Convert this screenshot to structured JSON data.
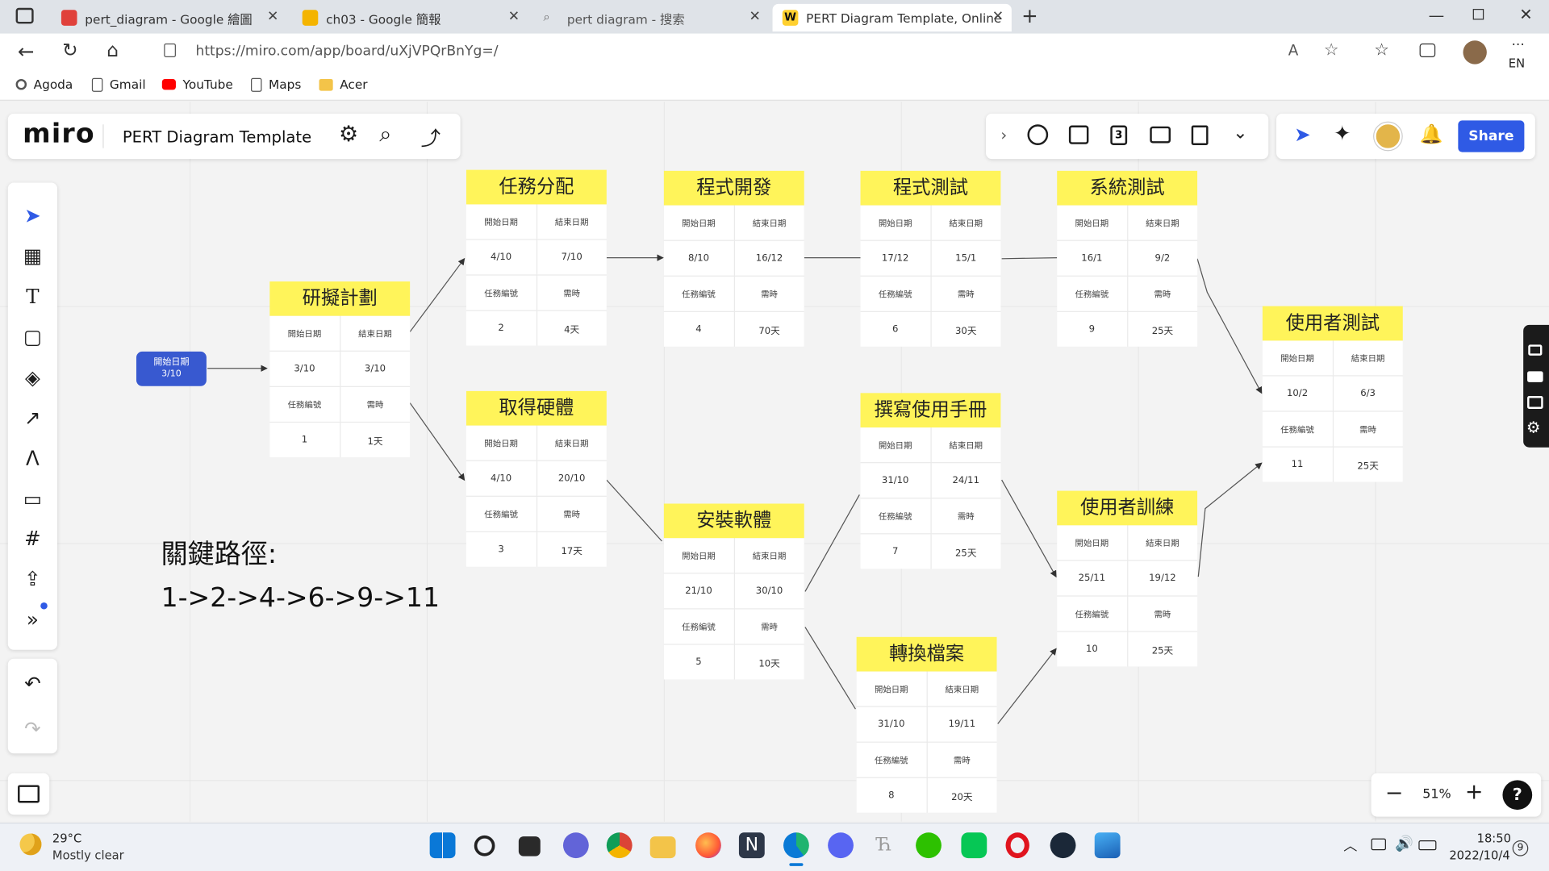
{
  "browser": {
    "tabs": [
      {
        "title": "pert_diagram - Google 繪圖",
        "icon": "google-drawings-icon"
      },
      {
        "title": "ch03 - Google 簡報",
        "icon": "google-slides-icon"
      },
      {
        "title": "pert diagram - 搜索",
        "icon": "search-icon"
      },
      {
        "title": "PERT Diagram Template, Online",
        "icon": "miro-icon"
      }
    ],
    "url": "https://miro.com/app/board/uXjVPQrBnYg=/",
    "lang": "EN",
    "bookmarks": [
      "Agoda",
      "Gmail",
      "YouTube",
      "Maps",
      "Acer"
    ]
  },
  "miro": {
    "logo": "miro",
    "board_title": "PERT Diagram Template",
    "share_label": "Share",
    "zoom": "51%",
    "help": "?",
    "toolbar_number_badge": "3"
  },
  "start": {
    "label": "開始日期",
    "date": "3/10"
  },
  "field_labels": {
    "start": "開始日期",
    "end": "結束日期",
    "id": "任務編號",
    "duration": "需時"
  },
  "tasks": [
    {
      "title": "研擬計劃",
      "start": "3/10",
      "end": "3/10",
      "id": "1",
      "duration": "1天"
    },
    {
      "title": "任務分配",
      "start": "4/10",
      "end": "7/10",
      "id": "2",
      "duration": "4天"
    },
    {
      "title": "取得硬體",
      "start": "4/10",
      "end": "20/10",
      "id": "3",
      "duration": "17天"
    },
    {
      "title": "程式開發",
      "start": "8/10",
      "end": "16/12",
      "id": "4",
      "duration": "70天"
    },
    {
      "title": "安裝軟體",
      "start": "21/10",
      "end": "30/10",
      "id": "5",
      "duration": "10天"
    },
    {
      "title": "程式測試",
      "start": "17/12",
      "end": "15/1",
      "id": "6",
      "duration": "30天"
    },
    {
      "title": "撰寫使用手冊",
      "start": "31/10",
      "end": "24/11",
      "id": "7",
      "duration": "25天"
    },
    {
      "title": "轉換檔案",
      "start": "31/10",
      "end": "19/11",
      "id": "8",
      "duration": "20天"
    },
    {
      "title": "系統測試",
      "start": "16/1",
      "end": "9/2",
      "id": "9",
      "duration": "25天"
    },
    {
      "title": "使用者訓練",
      "start": "25/11",
      "end": "19/12",
      "id": "10",
      "duration": "25天"
    },
    {
      "title": "使用者測試",
      "start": "10/2",
      "end": "6/3",
      "id": "11",
      "duration": "25天"
    }
  ],
  "critical_path": {
    "label": "關鍵路徑:",
    "path": "1->2->4->6->9->11"
  },
  "taskbar": {
    "weather_temp": "29°C",
    "weather_desc": "Mostly clear",
    "time": "18:50",
    "date": "2022/10/4",
    "notif_count": "9"
  },
  "colors": {
    "note_yellow": "#fff45a",
    "start_blue": "#3859d0",
    "share_blue": "#2f5ae5"
  }
}
